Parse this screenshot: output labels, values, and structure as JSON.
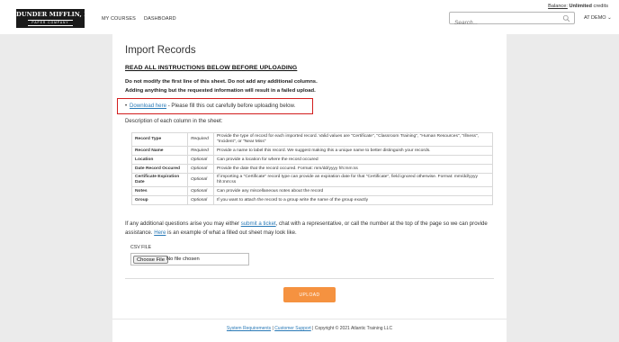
{
  "header": {
    "logo_main": "DUNDER MIFFLIN, INC",
    "logo_sub": "PAPER COMPANY",
    "nav": [
      "MY COURSES",
      "DASHBOARD"
    ],
    "balance_label": "Balance:",
    "balance_value": "Unlimited",
    "balance_suffix": "credits",
    "search_placeholder": "Search...",
    "user_menu": "AT DEMO ⌄"
  },
  "page": {
    "title": "Import Records",
    "warning_heading": "READ ALL INSTRUCTIONS BELOW BEFORE UPLOADING",
    "warning_line1": "Do not modify the first line of this sheet. Do not add any additional columns.",
    "warning_line2": "Adding anything but the requested information will result in a failed upload.",
    "download_link": "Download here",
    "download_suffix": " - Please fill this out carefully before uploading below.",
    "columns_intro": "Description of each column in the sheet:"
  },
  "columns_table": [
    {
      "name": "Record Type",
      "req": "Required",
      "desc": "Provide the type of record for each imported record. Valid values are \"Certificate\", \"Classroom Training\", \"Human Resources\", \"Illness\", \"Incident\", or \"Near Miss\""
    },
    {
      "name": "Record Name",
      "req": "Required",
      "desc": "Provide a name to label this record. We suggest making this a unique name to better distinguish your records."
    },
    {
      "name": "Location",
      "req": "Optional",
      "desc": "Can provide a location for where the record occured"
    },
    {
      "name": "Date Record Occured",
      "req": "Optional",
      "desc": "Provide the date that the record occured. Format: mm/dd/yyyy hh:mm:ss"
    },
    {
      "name": "Certificate Expiration Date",
      "req": "Optional",
      "desc": "If importing a \"Certificate\" record type can provide an expiration date for that \"Certificate\", field ignored otherwise. Format: mm/dd/yyyy hh:mm:ss"
    },
    {
      "name": "Notes",
      "req": "Optional",
      "desc": "Can provide any miscellaneous notes about the record"
    },
    {
      "name": "Group",
      "req": "Optional",
      "desc": "If you want to attach the record to a group write the name of the group exactly"
    }
  ],
  "help": {
    "part1": "If any additional questions arise you may either ",
    "link1": "submit a ticket",
    "part2": ", chat with a representative, or call the number at the top of the page so we can provide assistance. ",
    "link2": "Here",
    "part3": " is an example of what a filled out sheet may look like."
  },
  "upload": {
    "csv_label": "CSV FILE",
    "choose_button": "Choose File",
    "file_status": "No file chosen",
    "upload_button": "UPLOAD"
  },
  "footer": {
    "link1": "System Requirements",
    "sep": " | ",
    "link2": "Customer Support",
    "copyright": " | Copyright © 2021 Atlantic Training LLC"
  },
  "colors": {
    "background": "#ebebeb",
    "highlight_box": "#d21d1d",
    "link": "#2a7ab7",
    "upload_button": "#f59240"
  }
}
